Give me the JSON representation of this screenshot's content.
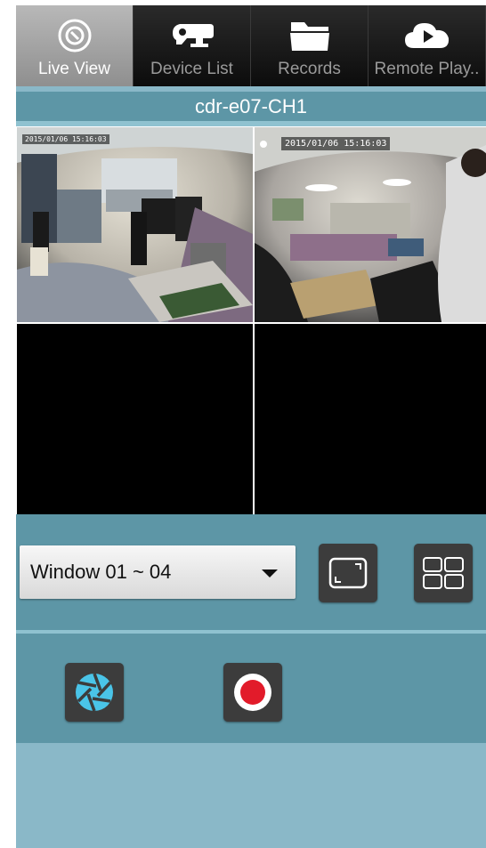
{
  "tabs": [
    {
      "label": "Live View",
      "icon": "live-view-icon",
      "active": true
    },
    {
      "label": "Device List",
      "icon": "camera-icon",
      "active": false
    },
    {
      "label": "Records",
      "icon": "folder-icon",
      "active": false
    },
    {
      "label": "Remote Play..",
      "icon": "cloud-play-icon",
      "active": false
    }
  ],
  "header": {
    "title": "cdr-e07-CH1"
  },
  "cameras": [
    {
      "timestamp": "2015/01/06 15:16:03",
      "selected": true
    },
    {
      "timestamp": "2015/01/06 15:16:03",
      "selected": false
    }
  ],
  "controls": {
    "window_select": "Window 01 ~ 04",
    "fullscreen_icon": "fullscreen-icon",
    "layout_icon": "quad-layout-icon",
    "snapshot_icon": "shutter-icon",
    "record_icon": "record-icon"
  },
  "colors": {
    "accent": "#5d96a6",
    "selection": "#f3f322",
    "record": "#e21b2a",
    "shutter": "#4ac4e8"
  }
}
